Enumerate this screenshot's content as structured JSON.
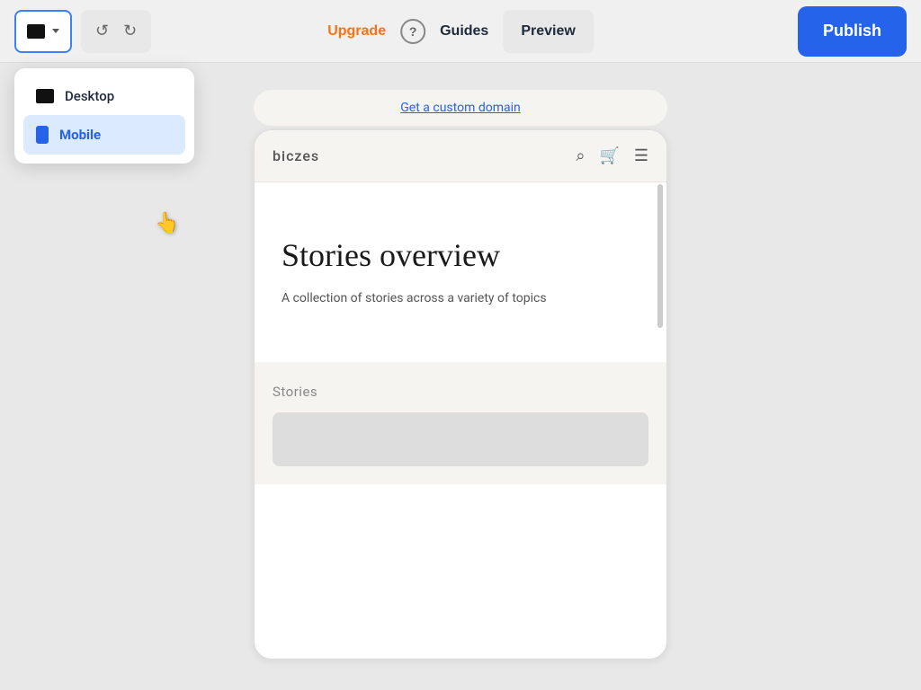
{
  "toolbar": {
    "device_selector_icon": "monitor",
    "undo_label": "↺",
    "redo_label": "↻",
    "upgrade_label": "Upgrade",
    "help_label": "?",
    "guides_label": "Guides",
    "preview_label": "Preview",
    "publish_label": "Publish"
  },
  "dropdown": {
    "desktop_label": "Desktop",
    "mobile_label": "Mobile"
  },
  "preview_area": {
    "custom_domain_text": "Get a custom domain",
    "site_logo": "biczes",
    "stories_title": "Stories overview",
    "stories_subtitle": "A collection of stories across a variety of topics",
    "stories_section_label": "Stories"
  }
}
